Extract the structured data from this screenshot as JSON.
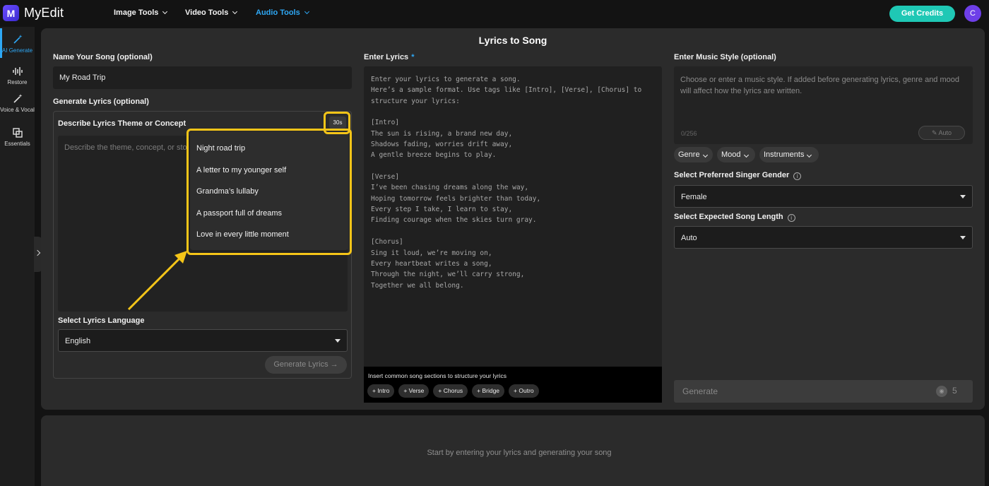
{
  "app": {
    "name": "MyEdit",
    "logo_letter": "M"
  },
  "nav": {
    "image_tools": "Image Tools",
    "video_tools": "Video Tools",
    "audio_tools": "Audio Tools"
  },
  "header": {
    "credits_button": "Get Credits",
    "avatar_initial": "C"
  },
  "sidebar": {
    "items": [
      {
        "label": "AI Generate",
        "icon": "magic-wand-icon"
      },
      {
        "label": "Restore",
        "icon": "waveform-icon"
      },
      {
        "label": "Voice & Vocal",
        "icon": "magic-wand-icon"
      },
      {
        "label": "Essentials",
        "icon": "copy-icon"
      }
    ]
  },
  "page": {
    "title": "Lyrics to Song"
  },
  "song_name": {
    "label": "Name Your Song (optional)",
    "value": "My Road Trip"
  },
  "generate_lyrics": {
    "section_label": "Generate Lyrics (optional)",
    "theme_label": "Describe Lyrics Theme or Concept",
    "dice_label": "30s",
    "placeholder": "Describe the theme, concept, or sto",
    "language_label": "Select Lyrics Language",
    "language_value": "English",
    "button": "Generate Lyrics →"
  },
  "theme_dropdown": {
    "items": [
      "Night road trip",
      "A letter to my younger self",
      "Grandma’s lullaby",
      "A passport full of dreams",
      "Love in every little moment"
    ]
  },
  "lyrics": {
    "label": "Enter Lyrics",
    "required_mark": "*",
    "placeholder": "Enter your lyrics to generate a song.\nHere’s a sample format. Use tags like [Intro], [Verse], [Chorus] to\nstructure your lyrics:\n\n[Intro]\nThe sun is rising, a brand new day,\nShadows fading, worries drift away,\nA gentle breeze begins to play.\n\n[Verse]\nI’ve been chasing dreams along the way,\nHoping tomorrow feels brighter than today,\nEvery step I take, I learn to stay,\nFinding courage when the skies turn gray.\n\n[Chorus]\nSing it loud, we’re moving on,\nEvery heartbeat writes a song,\nThrough the night, we’ll carry strong,\nTogether we all belong.",
    "insert_title": "Insert common song sections to structure your lyrics",
    "chips": [
      "+ Intro",
      "+ Verse",
      "+ Chorus",
      "+ Bridge",
      "+ Outro"
    ]
  },
  "music_style": {
    "label": "Enter Music Style (optional)",
    "placeholder": "Choose or enter a music style. If added before generating lyrics, genre and mood will affect how the lyrics are written.",
    "counter": "0/256",
    "auto_button": "Auto",
    "pills": [
      "Genre",
      "Mood",
      "Instruments"
    ]
  },
  "singer_gender": {
    "label": "Select Preferred Singer Gender",
    "value": "Female"
  },
  "song_length": {
    "label": "Select Expected Song Length",
    "value": "Auto"
  },
  "generate": {
    "label": "Generate",
    "credits": "5"
  },
  "bottom": {
    "message": "Start by entering your lyrics and generating your song"
  },
  "colors": {
    "accent": "#2ea8f5",
    "credits": "#1fc8b5",
    "highlight": "#f5c518",
    "avatar": "#6e3fe8"
  }
}
